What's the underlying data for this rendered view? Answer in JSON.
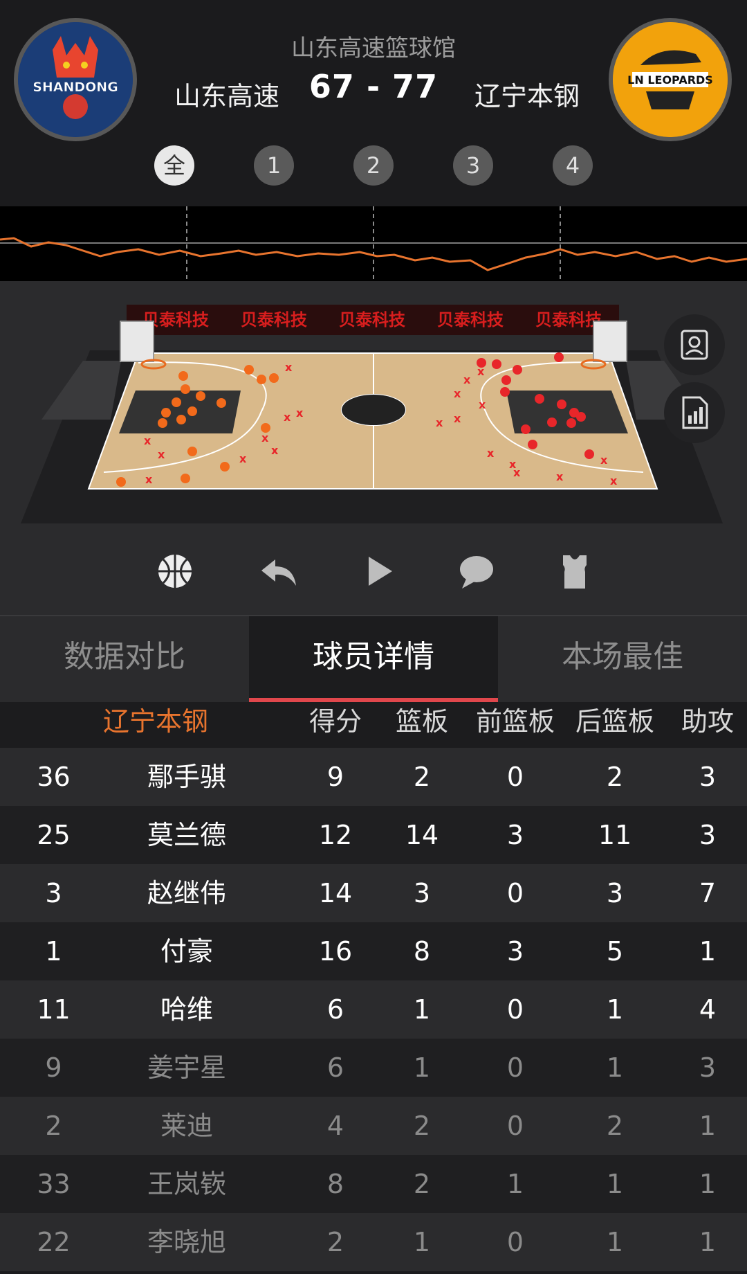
{
  "header": {
    "venue": "山东高速篮球馆",
    "home_team": "山东高速",
    "away_team": "辽宁本钢",
    "score": "67 - 77",
    "home_logo_text": "SHANDONG",
    "away_logo_text": "LN LEOPARDS"
  },
  "quarters": [
    "全",
    "1",
    "2",
    "3",
    "4"
  ],
  "court": {
    "sponsor_banner": [
      "贝泰科技",
      "贝泰科技",
      "贝泰科技",
      "贝泰科技",
      "贝泰科技"
    ]
  },
  "controls": [
    "basketball-icon",
    "replay-icon",
    "play-icon",
    "comment-icon",
    "jersey-icon"
  ],
  "tabs": [
    "数据对比",
    "球员详情",
    "本场最佳"
  ],
  "table": {
    "team": "辽宁本钢",
    "columns": [
      "得分",
      "篮板",
      "前篮板",
      "后篮板",
      "助攻"
    ],
    "rows": [
      {
        "num": "36",
        "name": "鄢手骐",
        "pts": "9",
        "reb": "2",
        "oreb": "0",
        "dreb": "2",
        "ast": "3"
      },
      {
        "num": "25",
        "name": "莫兰德",
        "pts": "12",
        "reb": "14",
        "oreb": "3",
        "dreb": "11",
        "ast": "3"
      },
      {
        "num": "3",
        "name": "赵继伟",
        "pts": "14",
        "reb": "3",
        "oreb": "0",
        "dreb": "3",
        "ast": "7"
      },
      {
        "num": "1",
        "name": "付豪",
        "pts": "16",
        "reb": "8",
        "oreb": "3",
        "dreb": "5",
        "ast": "1"
      },
      {
        "num": "11",
        "name": "哈维",
        "pts": "6",
        "reb": "1",
        "oreb": "0",
        "dreb": "1",
        "ast": "4"
      },
      {
        "num": "9",
        "name": "姜宇星",
        "pts": "6",
        "reb": "1",
        "oreb": "0",
        "dreb": "1",
        "ast": "3"
      },
      {
        "num": "2",
        "name": "莱迪",
        "pts": "4",
        "reb": "2",
        "oreb": "0",
        "dreb": "2",
        "ast": "1"
      },
      {
        "num": "33",
        "name": "王岚嵚",
        "pts": "8",
        "reb": "2",
        "oreb": "1",
        "dreb": "1",
        "ast": "1"
      },
      {
        "num": "22",
        "name": "李晓旭",
        "pts": "2",
        "reb": "1",
        "oreb": "0",
        "dreb": "1",
        "ast": "1"
      }
    ]
  },
  "colors": {
    "accent": "#e0474c",
    "team_label": "#e8742e",
    "trend_line": "#e8742e",
    "make": "#f26a1b",
    "miss": "#e8262a"
  }
}
